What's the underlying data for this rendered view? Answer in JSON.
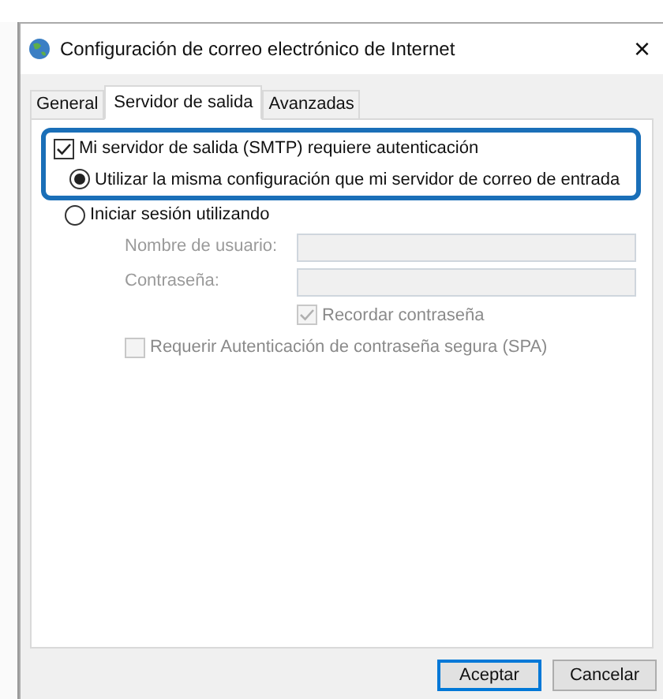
{
  "window": {
    "title": "Configuración de correo electrónico de Internet",
    "close": "×"
  },
  "tabs": [
    {
      "label": "General",
      "selected": false
    },
    {
      "label": "Servidor de salida",
      "selected": true
    },
    {
      "label": "Avanzadas",
      "selected": false
    }
  ],
  "smtp_auth": {
    "label": "Mi servidor de salida (SMTP) requiere autenticación",
    "checked": true
  },
  "auth_options": [
    {
      "label": "Utilizar la misma configuración que mi servidor de correo de entrada",
      "selected": true
    },
    {
      "label": "Iniciar sesión utilizando",
      "selected": false
    }
  ],
  "fields": [
    {
      "label": "Nombre de usuario:",
      "disabled": true
    },
    {
      "label": "Contraseña:",
      "disabled": true
    }
  ],
  "remember_password": {
    "label": "Recordar contraseña",
    "checked": true,
    "disabled": true
  },
  "spa": {
    "label": "Requerir Autenticación de contraseña segura (SPA)",
    "checked": false,
    "disabled": true
  },
  "buttons": [
    {
      "label": "Aceptar",
      "default": true
    },
    {
      "label": "Cancelar",
      "default": false
    }
  ]
}
